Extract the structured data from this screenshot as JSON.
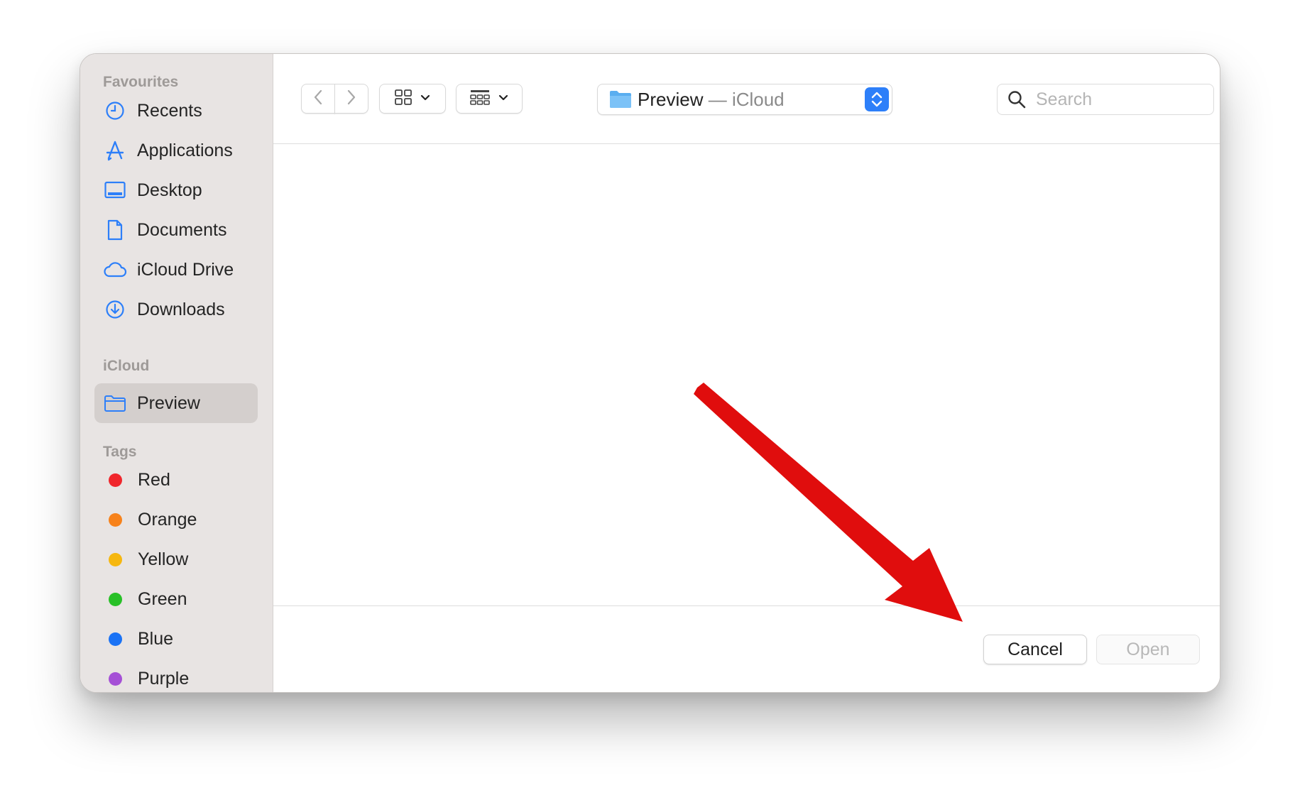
{
  "sidebar": {
    "favourites_title": "Favourites",
    "favourites": [
      {
        "label": "Recents",
        "icon": "clock-icon"
      },
      {
        "label": "Applications",
        "icon": "applications-icon"
      },
      {
        "label": "Desktop",
        "icon": "desktop-icon"
      },
      {
        "label": "Documents",
        "icon": "document-icon"
      },
      {
        "label": "iCloud Drive",
        "icon": "cloud-icon"
      },
      {
        "label": "Downloads",
        "icon": "download-icon"
      }
    ],
    "icloud_title": "iCloud",
    "icloud": [
      {
        "label": "Preview",
        "icon": "folder-icon",
        "selected": true
      }
    ],
    "tags_title": "Tags",
    "tags": [
      {
        "label": "Red",
        "color": "#f0262c"
      },
      {
        "label": "Orange",
        "color": "#f7821b"
      },
      {
        "label": "Yellow",
        "color": "#f6b70f"
      },
      {
        "label": "Green",
        "color": "#28c027"
      },
      {
        "label": "Blue",
        "color": "#1a72f5"
      },
      {
        "label": "Purple",
        "color": "#a550d6"
      }
    ]
  },
  "toolbar": {
    "back_icon": "chevron-left-icon",
    "forward_icon": "chevron-right-icon",
    "view_icon": "grid-view-icon",
    "group_icon": "group-view-icon",
    "location_name": "Preview",
    "location_separator": " — ",
    "location_service": "iCloud",
    "search_placeholder": "Search"
  },
  "footer": {
    "cancel_label": "Cancel",
    "open_label": "Open"
  },
  "colors": {
    "accent": "#2d7ff9",
    "annotation_arrow": "#e00d0d",
    "sidebar_bg": "#e8e4e3"
  }
}
